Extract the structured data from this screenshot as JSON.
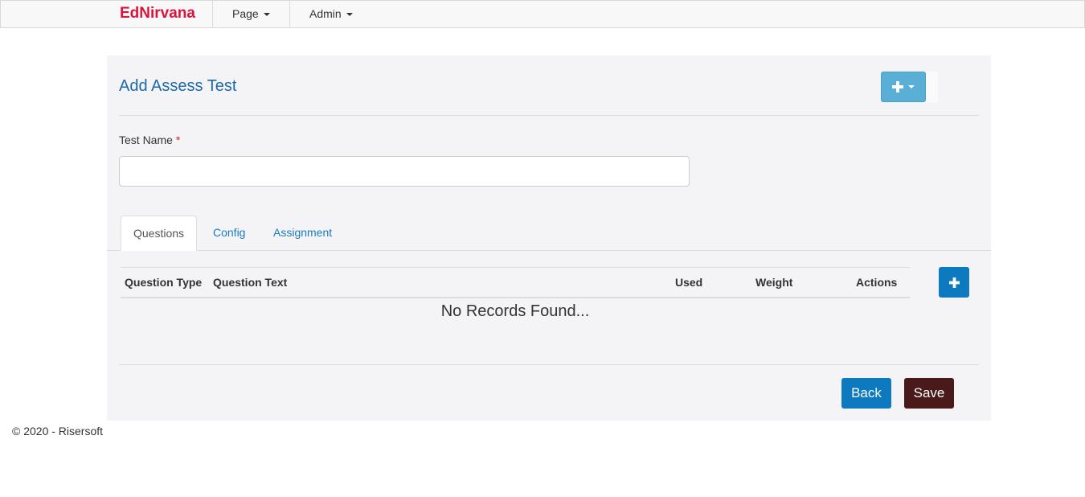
{
  "navbar": {
    "brand": "EdNirvana",
    "menus": [
      {
        "label": "Page"
      },
      {
        "label": "Admin"
      }
    ]
  },
  "panel": {
    "title": "Add Assess Test",
    "add_button_icon": "plus-icon",
    "form": {
      "test_name_label": "Test Name",
      "required_mark": "*",
      "test_name_value": "",
      "test_name_placeholder": ""
    },
    "tabs": [
      {
        "label": "Questions",
        "active": true
      },
      {
        "label": "Config",
        "active": false
      },
      {
        "label": "Assignment",
        "active": false
      }
    ],
    "table": {
      "columns": [
        "Question Type",
        "Question Text",
        "Used",
        "Weight",
        "Actions"
      ],
      "empty_message": "No Records Found..."
    },
    "buttons": {
      "back": "Back",
      "save": "Save"
    }
  },
  "footer": {
    "text": "© 2020 - Risersoft"
  },
  "colors": {
    "brand": "#dc143c",
    "title": "#1a6aa8",
    "primary": "#0d7ac0",
    "save": "#4a1a1a",
    "dropdown_button": "#5aafd6"
  }
}
